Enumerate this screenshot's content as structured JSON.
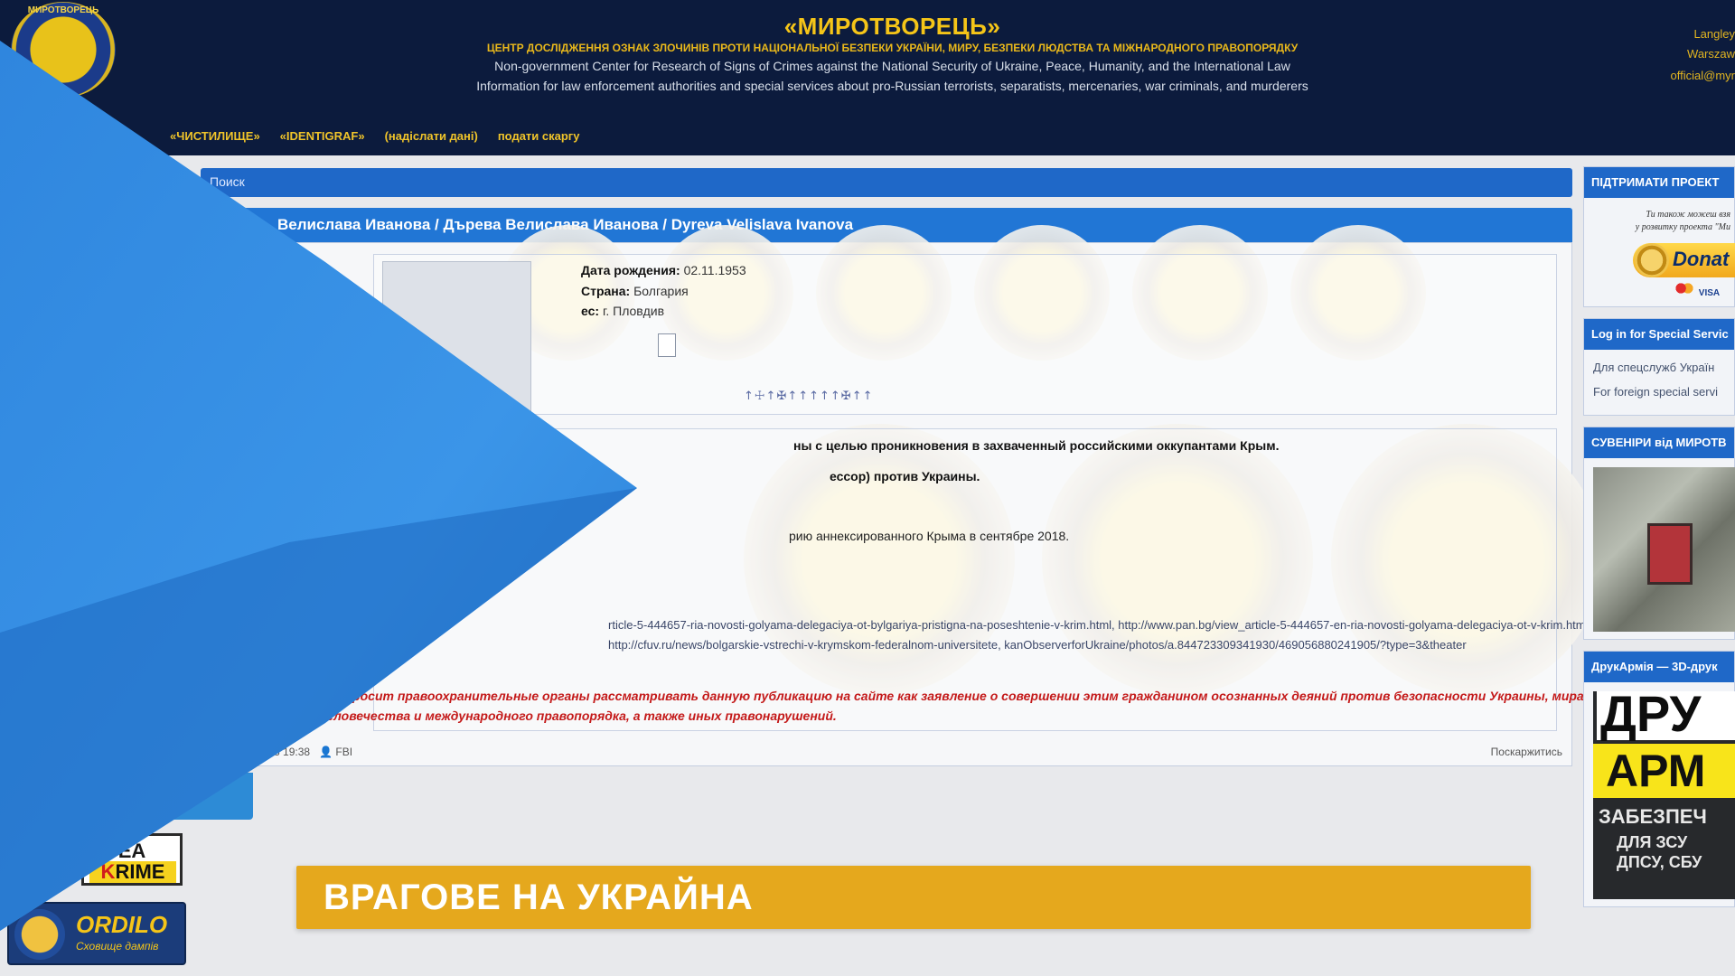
{
  "header": {
    "logo_text": "МИРОТВОРЕЦЬ",
    "title": "«МИРОТВОРЕЦЬ»",
    "subtitle_ua": "ЦЕНТР ДОСЛІДЖЕННЯ ОЗНАК ЗЛОЧИНІВ ПРОТИ НАЦІОНАЛЬНОЇ БЕЗПЕКИ УКРАЇНИ, МИРУ, БЕЗПЕКИ ЛЮДСТВА ТА МІЖНАРОДНОГО ПРАВОПОРЯДКУ",
    "subtitle_en1": "Non-government Center for Research of Signs of Crimes against the National Security of Ukraine, Peace, Humanity, and the International Law",
    "subtitle_en2": "Information for law enforcement authorities and special services about pro-Russian terrorists, separatists, mercenaries, war criminals, and murderers",
    "contact": [
      "Langley",
      "Warszaw",
      "official@myr"
    ]
  },
  "menu": [
    "«ЧИСТИЛИЩЕ»",
    "«IDENTIGRAF»",
    "(надіслати дані)",
    "подати скаргу"
  ],
  "breadcrumb": "Поиск",
  "profile": {
    "name_bar": "Велислава Иванова / Дърева Велислава Иванова / Dyreva Velislava Ivanova",
    "dob_label": "Дата рождения:",
    "dob_value": "02.11.1953",
    "country_label": "Страна:",
    "country_value": "Болгария",
    "addr_label": "ес:",
    "addr_value": "г. Пловдив",
    "icons_row": "↑☩↑✠↑↑↑↑↑✠↑↑",
    "text1": "ны с целью проникновения в захваченный российскими оккупантами Крым.",
    "text2": "ессор) против Украины.",
    "text3": "рию аннексированного Крыма в сентябре 2018.",
    "links": "rticle-5-444657-ria-novosti-golyama-delegaciya-ot-bylgariya-pristigna-na-poseshtenie-v-krim.html, http://www.pan.bg/view_article-5-444657-en-ria-novosti-golyama-delegaciya-ot-v-krim.html, http://cfuv.ru/news/bolgarskie-vstrechi-v-krymskom-federalnom-universitete, kanObserverforUkraine/photos/a.844723309341930/469056880241905/?type=3&theater",
    "warning": "ец» просит правоохранительные органы рассматривать данную публикацию на сайте как заявление о совершении этим гражданином осознанных деяний против безопасности Украины, мира, безопасности человечества и международного правопорядка, а также иных правонарушений.",
    "meta_date": "2018 19:38",
    "meta_author": "FBI",
    "complain": "Поскаржитись"
  },
  "sidebar": {
    "support_title": "ПІДТРИМАТИ ПРОЕКТ",
    "support_text1": "Ти також можеш взя",
    "support_text2": "у розвитку проекта \"Ми",
    "donate": "Donat",
    "cards": "VISA",
    "login_title": "Log in for Special Servic",
    "login_ua": "Для спецслужб Україн",
    "login_en": "For foreign special servi",
    "souvenir_title": "СУВЕНІРИ від МИРОТВ",
    "druk_title": "ДрукАрмія — 3D-друк",
    "druk_lines": [
      "ДРУ",
      "АРМ",
      "ЗАБЕЗПЕЧ",
      "ДЛЯ ЗСУ",
      "ДПСУ, СБУ"
    ]
  },
  "badges": {
    "krime_top": "EA",
    "krime_k": "K",
    "krime_rest": "RIME",
    "ordilo_title": "ORDILO",
    "ordilo_sub": "Сховище дампів"
  },
  "caption": "ВРАГОВЕ НА УКРАЙНА",
  "colors": {
    "header_bg": "#0c1b3d",
    "accent_blue": "#2176d5",
    "caption_bg": "#e5a81d",
    "wedge": "#3b95e8"
  }
}
